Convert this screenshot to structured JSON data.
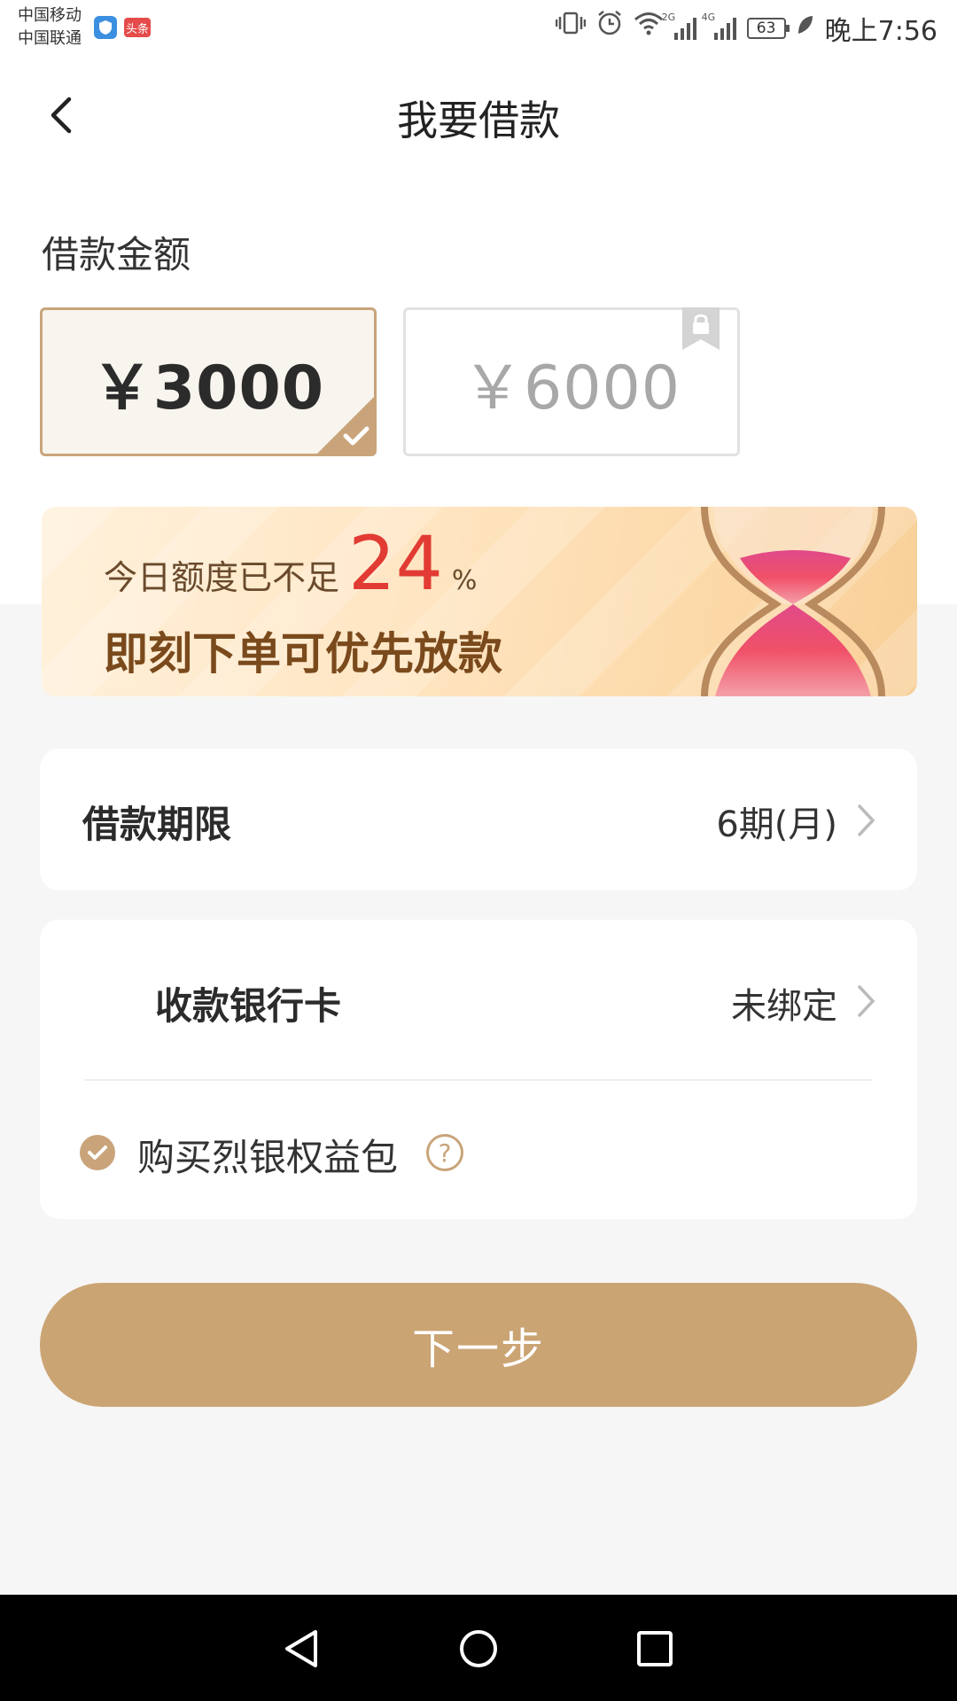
{
  "status_bar": {
    "carrier1": "中国移动",
    "carrier2": "中国联通",
    "toutiao_badge": "头条",
    "net_2g": "2G",
    "net_4g": "4G",
    "battery": "63",
    "time": "晚上7:56"
  },
  "header": {
    "title": "我要借款"
  },
  "amount_section": {
    "label": "借款金额",
    "options": [
      {
        "label": "￥3000",
        "selected": true,
        "locked": false
      },
      {
        "label": "￥6000",
        "selected": false,
        "locked": true
      }
    ]
  },
  "banner": {
    "prefix": "今日额度已不足",
    "percent": "24",
    "unit": "%",
    "headline": "即刻下单可优先放款"
  },
  "period_row": {
    "label": "借款期限",
    "value": "6期(月)"
  },
  "bank_row": {
    "label": "收款银行卡",
    "value": "未绑定"
  },
  "benefit_row": {
    "label": "购买烈银权益包",
    "checked": true
  },
  "next_button": {
    "label": "下一步"
  },
  "colors": {
    "accent": "#cba474",
    "highlight_red": "#e23b34",
    "selected_bg": "#f8f4ee"
  }
}
